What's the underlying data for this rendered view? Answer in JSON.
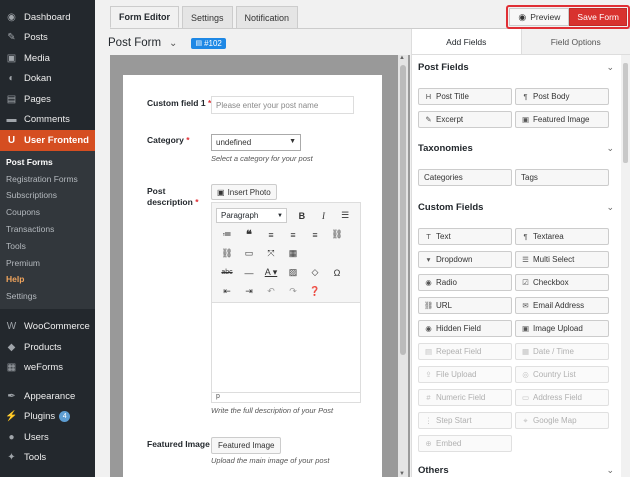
{
  "admin_menu": {
    "top": [
      {
        "label": "Dashboard",
        "icon": "dashboard-icon",
        "glyph": "◉"
      },
      {
        "label": "Posts",
        "icon": "pin-icon",
        "glyph": "✎"
      },
      {
        "label": "Media",
        "icon": "media-icon",
        "glyph": "▣"
      },
      {
        "label": "Dokan",
        "icon": "dokan-icon",
        "glyph": "◐"
      },
      {
        "label": "Pages",
        "icon": "pages-icon",
        "glyph": "▤"
      },
      {
        "label": "Comments",
        "icon": "comment-icon",
        "glyph": "▬"
      }
    ],
    "active": {
      "label": "User Frontend",
      "icon": "user-frontend-icon",
      "glyph": "U"
    },
    "submenu": [
      "Post Forms",
      "Registration Forms",
      "Subscriptions",
      "Coupons",
      "Transactions",
      "Tools",
      "Premium",
      "Help",
      "Settings"
    ],
    "bottom": [
      {
        "label": "WooCommerce",
        "icon": "woocommerce-icon",
        "glyph": "W"
      },
      {
        "label": "Products",
        "icon": "products-icon",
        "glyph": "◆"
      },
      {
        "label": "weForms",
        "icon": "weforms-icon",
        "glyph": "▦"
      }
    ],
    "bottom2": [
      {
        "label": "Appearance",
        "icon": "appearance-icon",
        "glyph": "✒"
      },
      {
        "label": "Plugins",
        "icon": "plugins-icon",
        "glyph": "⚡",
        "badge": "4"
      },
      {
        "label": "Users",
        "icon": "users-icon",
        "glyph": "●"
      },
      {
        "label": "Tools",
        "icon": "tools-icon",
        "glyph": "✦"
      }
    ]
  },
  "tabs": [
    "Form Editor",
    "Settings",
    "Notification"
  ],
  "form": {
    "title": "Post Form",
    "id": "#102"
  },
  "actions": {
    "preview": "Preview",
    "save": "Save Form"
  },
  "fields": {
    "custom_field": {
      "label": "Custom field 1",
      "placeholder": "Please enter your post name"
    },
    "category": {
      "label": "Category",
      "value": "undefined",
      "help": "Select a category for your post"
    },
    "description": {
      "label": "Post description",
      "insert_photo": "Insert Photo",
      "paragraph": "Paragraph",
      "status": "p",
      "help": "Write the full description of your Post"
    },
    "featured_image": {
      "label": "Featured Image",
      "button": "Featured Image",
      "help": "Upload the main image of your post"
    }
  },
  "right_panel": {
    "tabs": [
      "Add Fields",
      "Field Options"
    ],
    "sections": {
      "post_fields": "Post Fields",
      "taxonomies": "Taxonomies",
      "custom_fields": "Custom Fields",
      "others": "Others"
    },
    "post_fields": [
      "Post Title",
      "Post Body",
      "Excerpt",
      "Featured Image"
    ],
    "taxonomies": [
      "Categories",
      "Tags"
    ],
    "custom_fields": [
      "Text",
      "Textarea",
      "Dropdown",
      "Multi Select",
      "Radio",
      "Checkbox",
      "URL",
      "Email Address",
      "Hidden Field",
      "Image Upload"
    ],
    "custom_fields_disabled": [
      "Repeat Field",
      "Date / Time",
      "File Upload",
      "Country List",
      "Numeric Field",
      "Address Field",
      "Step Start",
      "Google Map",
      "Embed"
    ]
  }
}
